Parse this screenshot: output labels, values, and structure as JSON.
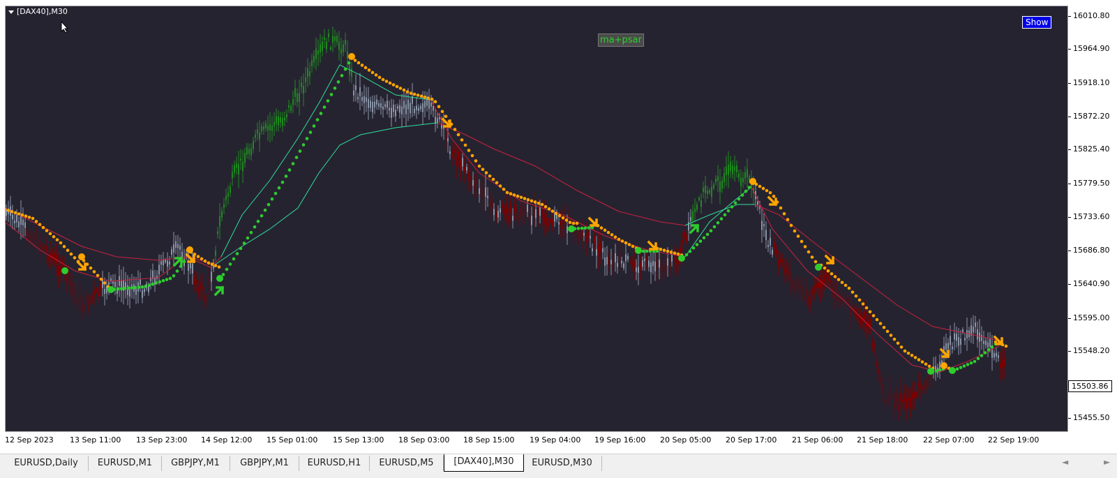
{
  "chart": {
    "symbol_label": "[DAX40],M30",
    "show_button": "Show",
    "indicator_label": "ma+psar",
    "current_price": "15503.86",
    "price_ticks": [
      "16010.80",
      "15964.90",
      "15918.10",
      "15872.20",
      "15825.40",
      "15779.50",
      "15733.60",
      "15686.80",
      "15640.90",
      "15595.00",
      "15548.20",
      "15455.50"
    ],
    "time_ticks": [
      "12 Sep 2023",
      "13 Sep 11:00",
      "13 Sep 23:00",
      "14 Sep 12:00",
      "15 Sep 01:00",
      "15 Sep 13:00",
      "18 Sep 03:00",
      "18 Sep 15:00",
      "19 Sep 04:00",
      "19 Sep 16:00",
      "20 Sep 05:00",
      "20 Sep 17:00",
      "21 Sep 06:00",
      "21 Sep 18:00",
      "22 Sep 07:00",
      "22 Sep 19:00"
    ],
    "colors": {
      "background": "#262331",
      "bull": "#1f8a1f",
      "bear": "#7a0000",
      "neutral": "#8a96a8",
      "psar_up": "#2ecc2e",
      "psar_down": "#ffa500",
      "ma_green": "#2ee09a",
      "ma_red": "#c8233c"
    }
  },
  "tabs": [
    {
      "label": "EURUSD,Daily"
    },
    {
      "label": "EURUSD,M1"
    },
    {
      "label": "GBPJPY,M1"
    },
    {
      "label": "GBPJPY,M1"
    },
    {
      "label": "EURUSD,H1"
    },
    {
      "label": "EURUSD,M5"
    },
    {
      "label": "[DAX40],M30",
      "active": true
    },
    {
      "label": "EURUSD,M30"
    }
  ],
  "scroll_icons": {
    "left": "◄",
    "right": "►"
  }
}
